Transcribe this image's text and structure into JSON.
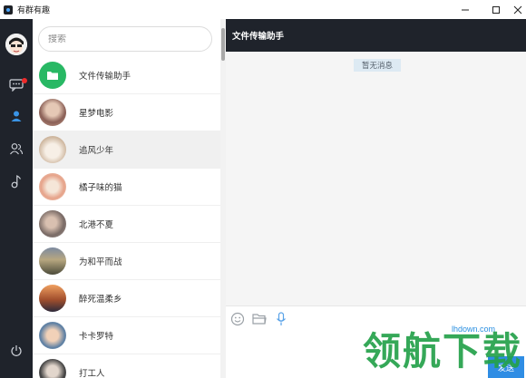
{
  "window": {
    "title": "有群有趣"
  },
  "search": {
    "placeholder": "搜索"
  },
  "contacts": [
    {
      "name": "文件传输助手",
      "avatar": "folder-avatar-icon",
      "color": "#28b864",
      "active": false
    },
    {
      "name": "星梦电影",
      "avatar": "user-avatar",
      "color": "#b58a7a",
      "active": false
    },
    {
      "name": "追风少年",
      "avatar": "user-avatar",
      "color": "#d9c7b6",
      "active": true
    },
    {
      "name": "橘子味的猫",
      "avatar": "user-avatar",
      "color": "#e8b09a",
      "active": false
    },
    {
      "name": "北港不夏",
      "avatar": "user-avatar",
      "color": "#8c7f7c",
      "active": false
    },
    {
      "name": "为和平而战",
      "avatar": "user-avatar",
      "color": "#5a5a48",
      "active": false
    },
    {
      "name": "醉死温柔乡",
      "avatar": "user-avatar",
      "color": "#9a5a36",
      "active": false
    },
    {
      "name": "卡卡罗特",
      "avatar": "user-avatar",
      "color": "#6f8aa6",
      "active": false
    },
    {
      "name": "打工人",
      "avatar": "user-avatar",
      "color": "#555555",
      "active": false
    }
  ],
  "chat": {
    "title": "文件传输助手",
    "empty_text": "暂无消息",
    "send_label": "发送"
  },
  "watermark": {
    "url": "lhdown.com",
    "text": "领航下载"
  },
  "colors": {
    "rail": "#1f232b",
    "accent": "#2f8de4",
    "badge": "#ee2a2a"
  }
}
